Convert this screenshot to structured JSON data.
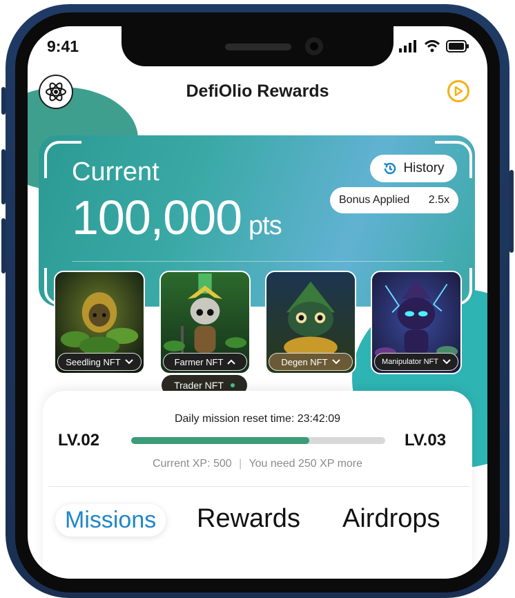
{
  "status_bar": {
    "time": "9:41"
  },
  "header": {
    "title": "DefiOlio Rewards"
  },
  "points_card": {
    "label": "Current",
    "points": "100,000",
    "unit": "pts",
    "history_label": "History",
    "bonus_label": "Bonus Applied",
    "bonus_value": "2.5x"
  },
  "nfts": [
    {
      "name": "Seedling NFT"
    },
    {
      "name": "Farmer NFT"
    },
    {
      "name": "Degen NFT"
    },
    {
      "name": "Manipulator NFT"
    }
  ],
  "trader_nft": "Trader NFT",
  "level": {
    "reset_text": "Daily mission reset time: 23:42:09",
    "current_level": "LV.02",
    "next_level": "LV.03",
    "progress_fraction": 0.7,
    "xp_text": "Current XP: 500",
    "xp_needed": "You need 250 XP more"
  },
  "tabs": [
    {
      "label": "Missions",
      "active": true
    },
    {
      "label": "Rewards",
      "active": false
    },
    {
      "label": "Airdrops",
      "active": false
    }
  ],
  "colors": {
    "accent": "#1f86c8",
    "progress": "#3c9b78",
    "play": "#f5b014"
  },
  "icons": {
    "logo": "atom-icon",
    "play": "play-circle-icon",
    "history": "history-icon",
    "chevron": "chevron-down-icon"
  }
}
